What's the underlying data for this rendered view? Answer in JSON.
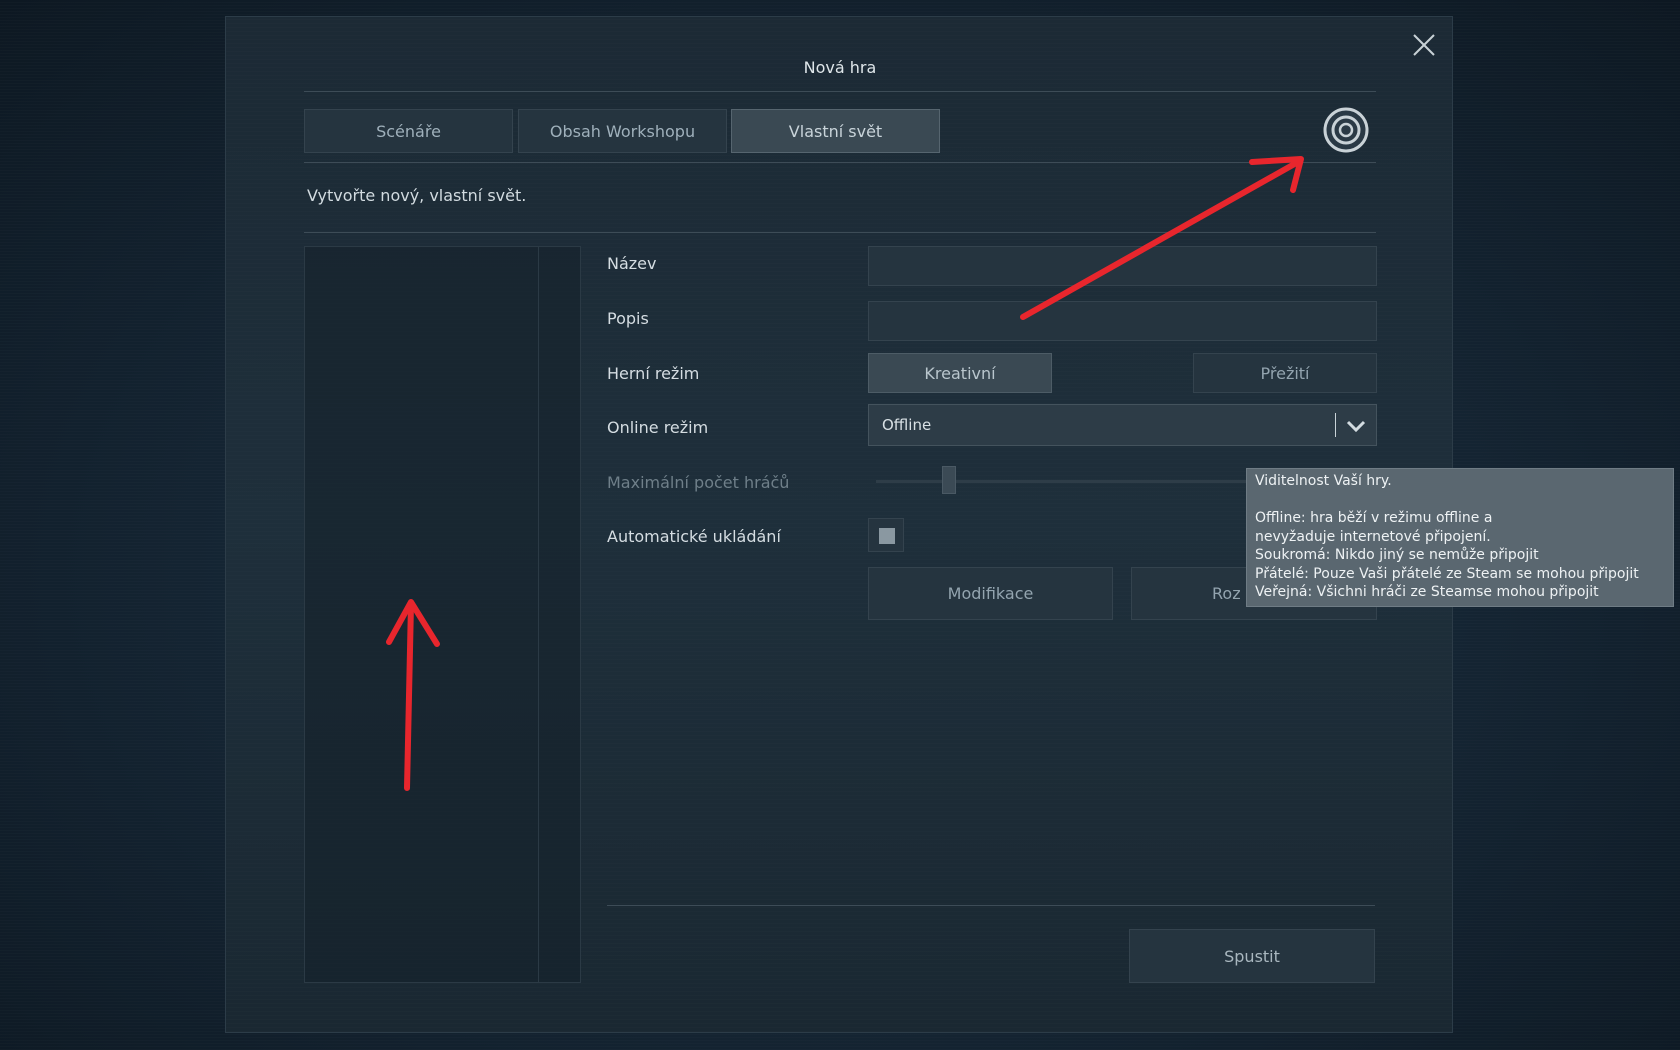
{
  "dialog": {
    "title": "Nová hra",
    "subtitle": "Vytvořte nový, vlastní svět."
  },
  "tabs": [
    {
      "label": "Scénáře",
      "active": false
    },
    {
      "label": "Obsah Workshopu",
      "active": false
    },
    {
      "label": "Vlastní svět",
      "active": true
    }
  ],
  "form": {
    "name_label": "Název",
    "name_value": "",
    "description_label": "Popis",
    "description_value": "",
    "game_mode_label": "Herní režim",
    "game_mode_options": [
      "Kreativní",
      "Přežití"
    ],
    "game_mode_selected": "Kreativní",
    "online_mode_label": "Online režim",
    "online_mode_value": "Offline",
    "max_players_label": "Maximální počet hráčů",
    "autosave_label": "Automatické ukládání",
    "autosave_checked": false,
    "mods_button": "Modifikace",
    "advanced_button_partial": "Roz"
  },
  "tooltip": {
    "lines": [
      "Viditelnost Vaší hry.",
      "",
      "Offline: hra běží v režimu offline a",
      "nevyžaduje internetové připojení.",
      "Soukromá: Nikdo jiný se nemůže připojit",
      "Přátelé: Pouze Vaši přátelé ze Steam se mohou připojit",
      "Veřejná: Všichni hráči ze Steamse mohou připojit"
    ]
  },
  "footer": {
    "start_button": "Spustit"
  },
  "icons": {
    "close": "close-icon",
    "settings": "settings-icon",
    "dropdown": "chevron-down-icon"
  },
  "colors": {
    "annotation_arrow": "#e8262d"
  }
}
